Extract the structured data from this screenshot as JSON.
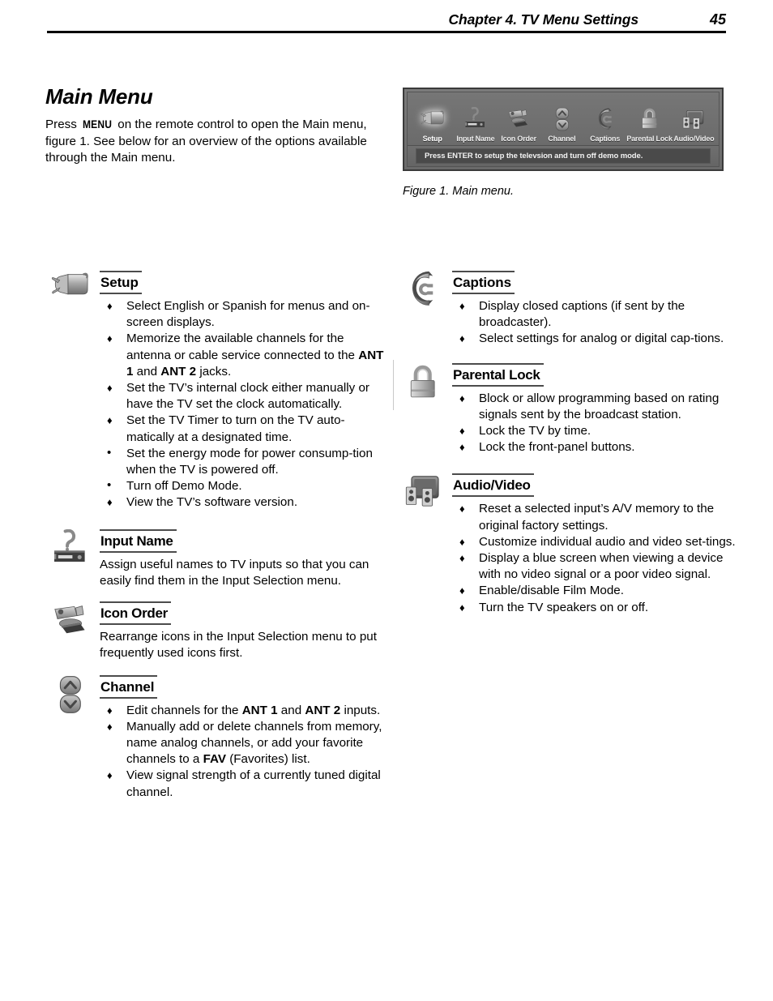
{
  "header": {
    "chapter": "Chapter 4. TV Menu Settings",
    "page_number": "45"
  },
  "intro": {
    "title": "Main Menu",
    "text_before_key": "Press ",
    "key_label": "MENU",
    "text_after_key": " on the remote control to open the Main menu, figure 1.  See below for an overview of the options available through the Main menu."
  },
  "figure": {
    "caption": "Figure 1.  Main menu.",
    "menu_items": [
      {
        "label": "Setup",
        "icon": "power-plug-icon",
        "selected": true
      },
      {
        "label": "Input Name",
        "icon": "vcr-question-icon",
        "selected": false
      },
      {
        "label": "Icon Order",
        "icon": "camcorder-icon",
        "selected": false
      },
      {
        "label": "Channel",
        "icon": "channel-updown-icon",
        "selected": false
      },
      {
        "label": "Captions",
        "icon": "captions-c-icon",
        "selected": false
      },
      {
        "label": "Parental Lock",
        "icon": "padlock-icon",
        "selected": false
      },
      {
        "label": "Audio/Video",
        "icon": "tv-speakers-icon",
        "selected": false
      }
    ],
    "status_bar": {
      "text_1": "Press ",
      "key": "ENTER",
      "text_2": " to setup the televsion and turn off demo mode."
    }
  },
  "left_column": [
    {
      "id": "setup",
      "heading": "Setup",
      "heading_style": "regular",
      "icon": "power-plug-icon",
      "bullets": [
        {
          "marker": "diamond",
          "parts": [
            {
              "t": "Select English or Spanish for menus and on-screen displays."
            }
          ]
        },
        {
          "marker": "diamond",
          "parts": [
            {
              "t": "Memorize the available channels for the antenna or cable service connected to the "
            },
            {
              "t": "ANT 1",
              "b": true
            },
            {
              "t": " and "
            },
            {
              "t": "ANT 2",
              "b": true
            },
            {
              "t": " jacks."
            }
          ]
        },
        {
          "marker": "diamond",
          "parts": [
            {
              "t": "Set the TV’s internal clock either manually or have the TV set the clock automatically."
            }
          ]
        },
        {
          "marker": "diamond",
          "parts": [
            {
              "t": "Set the TV Timer to turn on the TV auto-matically at a designated time."
            }
          ]
        },
        {
          "marker": "round",
          "parts": [
            {
              "t": "Set the energy mode for power consump-tion when the TV is powered off."
            }
          ]
        },
        {
          "marker": "round",
          "parts": [
            {
              "t": "Turn off Demo Mode."
            }
          ]
        },
        {
          "marker": "diamond",
          "parts": [
            {
              "t": "View the TV’s software version."
            }
          ]
        }
      ]
    },
    {
      "id": "input-name",
      "heading": "Input Name",
      "heading_style": "narrow",
      "icon": "vcr-question-icon",
      "paragraph": "Assign useful names to TV inputs so that you can easily find them in the Input Selection menu."
    },
    {
      "id": "icon-order",
      "heading": "Icon Order",
      "heading_style": "narrow",
      "icon": "camcorder-icon",
      "paragraph": "Rearrange icons in the Input Selection menu to put frequently used icons first."
    },
    {
      "id": "channel",
      "heading": "Channel",
      "heading_style": "regular",
      "icon": "channel-updown-icon",
      "bullets": [
        {
          "marker": "diamond",
          "parts": [
            {
              "t": "Edit channels for the "
            },
            {
              "t": "ANT 1",
              "b": true
            },
            {
              "t": " and "
            },
            {
              "t": "ANT 2",
              "b": true
            },
            {
              "t": " inputs."
            }
          ]
        },
        {
          "marker": "diamond",
          "parts": [
            {
              "t": "Manually add or delete channels from memory, name analog channels, or add your favorite channels to a "
            },
            {
              "t": "FAV",
              "b": true
            },
            {
              "t": " (Favorites) list."
            }
          ]
        },
        {
          "marker": "diamond",
          "parts": [
            {
              "t": "View signal strength of a currently tuned digital channel."
            }
          ]
        }
      ]
    }
  ],
  "right_column": [
    {
      "id": "captions",
      "heading": "Captions",
      "heading_style": "regular",
      "icon": "captions-c-icon",
      "bullets": [
        {
          "marker": "diamond",
          "parts": [
            {
              "t": "Display closed captions (if sent by the broadcaster)."
            }
          ]
        },
        {
          "marker": "diamond",
          "parts": [
            {
              "t": "Select settings for analog or digital cap-tions."
            }
          ]
        }
      ]
    },
    {
      "id": "parental-lock",
      "heading": "Parental Lock",
      "heading_style": "narrow",
      "icon": "padlock-icon",
      "bullets": [
        {
          "marker": "diamond",
          "parts": [
            {
              "t": "Block or allow programming based on rating signals sent by the broadcast station."
            }
          ]
        },
        {
          "marker": "diamond",
          "parts": [
            {
              "t": "Lock the TV by time."
            }
          ]
        },
        {
          "marker": "diamond",
          "parts": [
            {
              "t": "Lock the front-panel buttons."
            }
          ]
        }
      ]
    },
    {
      "id": "audio-video",
      "heading": "Audio/Video",
      "heading_style": "narrow",
      "icon": "tv-speakers-icon",
      "bullets": [
        {
          "marker": "diamond",
          "parts": [
            {
              "t": "Reset a selected input’s A/V memory to the original factory settings."
            }
          ]
        },
        {
          "marker": "diamond",
          "parts": [
            {
              "t": "Customize individual audio and video set-tings."
            }
          ]
        },
        {
          "marker": "diamond",
          "parts": [
            {
              "t": "Display a blue screen when viewing a device with no video signal or a poor video signal."
            }
          ]
        },
        {
          "marker": "diamond",
          "parts": [
            {
              "t": "Enable/disable Film Mode."
            }
          ]
        },
        {
          "marker": "diamond",
          "parts": [
            {
              "t": "Turn the TV speakers on or off."
            }
          ]
        }
      ]
    }
  ],
  "markers": {
    "diamond": "♦",
    "round": "•"
  },
  "colors": {
    "rule": "#4c4c4c",
    "text": "#000000",
    "menu_bg": "#6e6e6e"
  }
}
